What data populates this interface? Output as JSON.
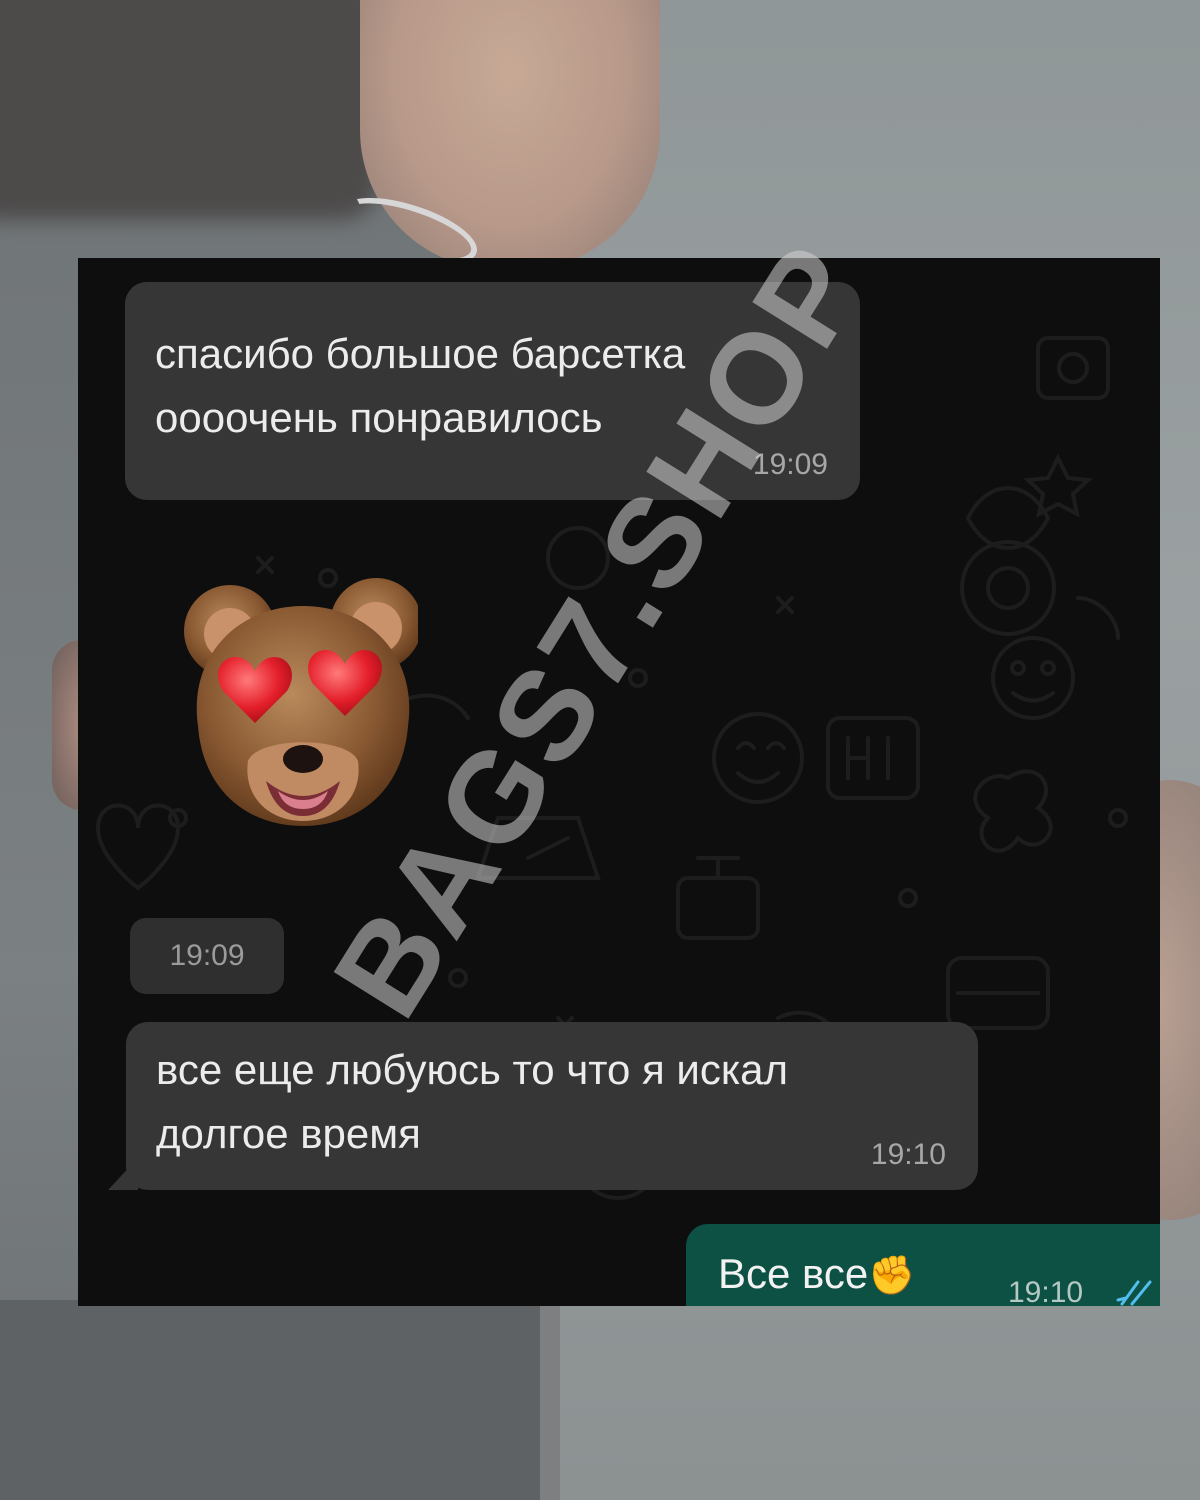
{
  "messages": [
    {
      "text_line1": "спасибо большое барсетка",
      "text_line2": "оооочень понравилось",
      "time": "19:09"
    },
    {
      "sticker": "bear-heart-eyes-icon",
      "time": "19:09"
    },
    {
      "text_line1": "все еще любуюсь то что я искал",
      "text_line2": "долгое время",
      "time": "19:10"
    }
  ],
  "outgoing": {
    "text": "Все все",
    "emoji": "✊",
    "time": "19:10",
    "status": "read-double-check-icon"
  },
  "watermark": "BAGS7.SHOP",
  "colors": {
    "incoming_bubble": "#363636",
    "outgoing_bubble": "#0d5145",
    "chat_bg": "#0e0e0e",
    "read_ticks": "#53bdeb"
  }
}
